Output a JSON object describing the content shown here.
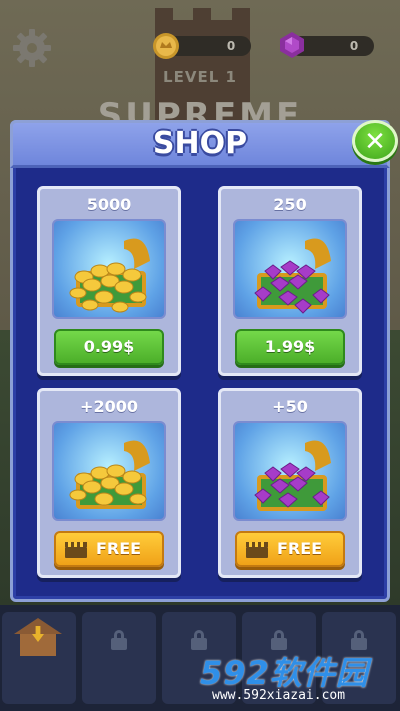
{
  "hud": {
    "coins": "0",
    "gems": "0",
    "level_text": "LEVEL 1",
    "title_text": "SUPREME"
  },
  "shop": {
    "title": "SHOP",
    "close_label": "✕",
    "items": [
      {
        "amount": "5000",
        "reward": "coins",
        "button": "0.99$",
        "button_type": "buy"
      },
      {
        "amount": "250",
        "reward": "gems",
        "button": "1.99$",
        "button_type": "buy"
      },
      {
        "amount": "+2000",
        "reward": "coins",
        "button": "FREE",
        "button_type": "free-video"
      },
      {
        "amount": "+50",
        "reward": "gems",
        "button": "FREE",
        "button_type": "free-video"
      }
    ]
  },
  "bottom_bar": {
    "slots": [
      "home",
      "locked",
      "locked",
      "locked",
      "locked"
    ]
  },
  "watermark": {
    "brand": "592软件园",
    "url": "www.592xiazai.com"
  },
  "colors": {
    "panel": "#1e2b8a",
    "header": "#7f95e3",
    "buy_green": "#5cc234",
    "free_orange": "#f7b524",
    "close_green": "#4cb524"
  },
  "icons": [
    "gear-icon",
    "coin-icon",
    "gem-icon",
    "close-icon",
    "coin-chest-icon",
    "gem-chest-icon",
    "clapperboard-icon",
    "home-icon",
    "lock-icon"
  ]
}
